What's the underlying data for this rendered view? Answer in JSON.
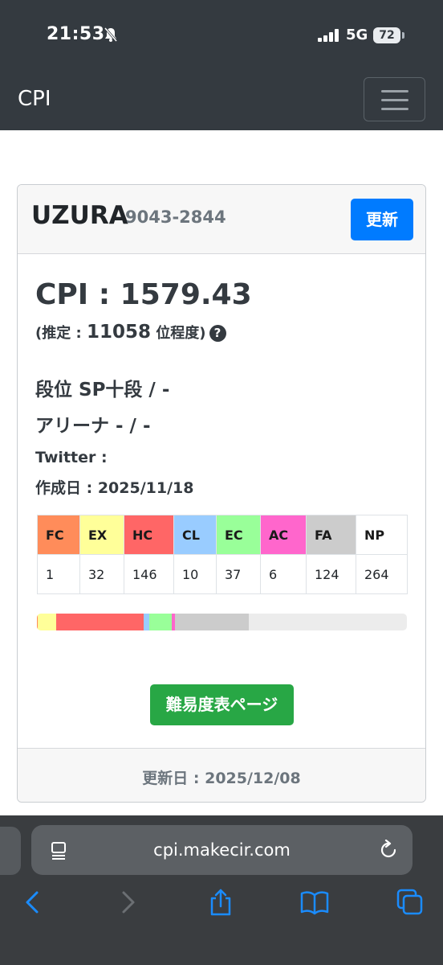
{
  "status_bar": {
    "time": "21:53",
    "network": "5G",
    "battery": "72"
  },
  "navbar": {
    "brand": "CPI"
  },
  "profile": {
    "name": "UZURA",
    "id": "9043-2844",
    "update_label": "更新",
    "cpi_label": "CPI : ",
    "cpi_value": "1579.43",
    "estimate_prefix": "(推定 : ",
    "estimate_rank": "11058",
    "estimate_suffix": " 位程度)",
    "help_symbol": "?",
    "dan": "段位 SP十段 / -",
    "arena": "アリーナ - / -",
    "twitter": "Twitter :",
    "created": "作成日 : 2025/11/18"
  },
  "lamps": {
    "headers": [
      "FC",
      "EX",
      "HC",
      "CL",
      "EC",
      "AC",
      "FA",
      "NP"
    ],
    "counts": [
      "1",
      "32",
      "146",
      "10",
      "37",
      "6",
      "124",
      "264"
    ],
    "colors": [
      "#ff8c5a",
      "#ffff99",
      "#ff6666",
      "#99ccff",
      "#99ff99",
      "#ff66cc",
      "#cccccc",
      "#ffffff"
    ]
  },
  "progress": {
    "segments": [
      {
        "name": "FC",
        "fraction": 0.0016,
        "color": "#ff8c5a"
      },
      {
        "name": "EX",
        "fraction": 0.0515,
        "color": "#ffff99"
      },
      {
        "name": "HC",
        "fraction": 0.2347,
        "color": "#ff6666"
      },
      {
        "name": "CL",
        "fraction": 0.0161,
        "color": "#99ccff"
      },
      {
        "name": "EC",
        "fraction": 0.0595,
        "color": "#99ff99"
      },
      {
        "name": "AC",
        "fraction": 0.0096,
        "color": "#ff66cc"
      },
      {
        "name": "FA",
        "fraction": 0.1994,
        "color": "#cccccc"
      }
    ]
  },
  "actions": {
    "table_page_label": "難易度表ページ"
  },
  "footer": {
    "updated": "更新日 : 2025/12/08"
  },
  "browser": {
    "url": "cpi.makecir.com"
  }
}
